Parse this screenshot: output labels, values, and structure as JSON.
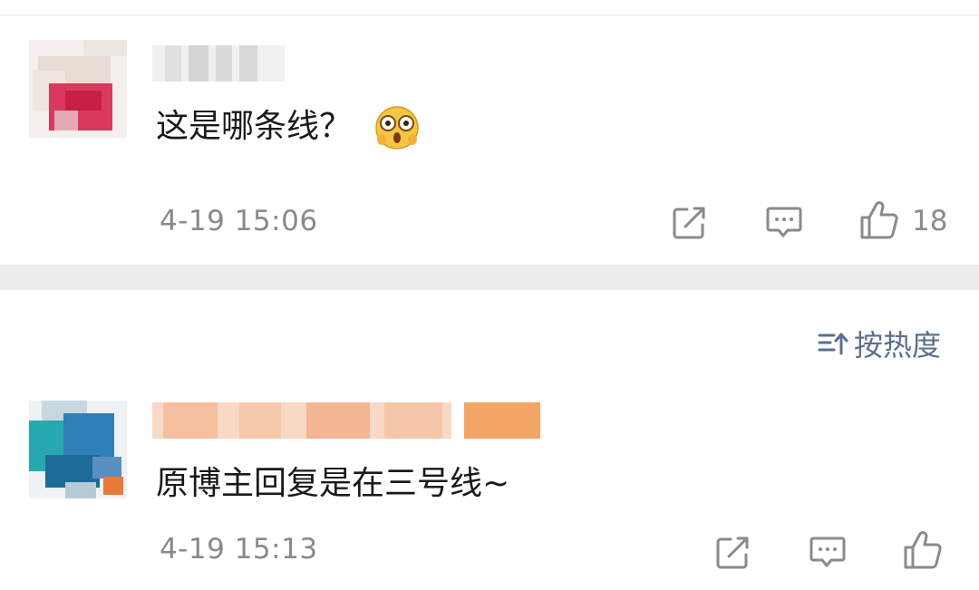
{
  "comments": [
    {
      "text": "这是哪条线？",
      "emoji": "surprised-emoji",
      "time": "4-19 15:06",
      "likes": "18"
    },
    {
      "text": "原博主回复是在三号线~",
      "time": "4-19 15:13"
    }
  ],
  "sort": {
    "label": "按热度"
  },
  "icons": {
    "repost": "repost-icon",
    "reply": "comment-icon",
    "like": "thumbs-up-icon",
    "sort": "sort-icon"
  },
  "colors": {
    "link_blue": "#5a6f8d",
    "meta_gray": "#8a8a8a",
    "divider": "#ececec"
  }
}
